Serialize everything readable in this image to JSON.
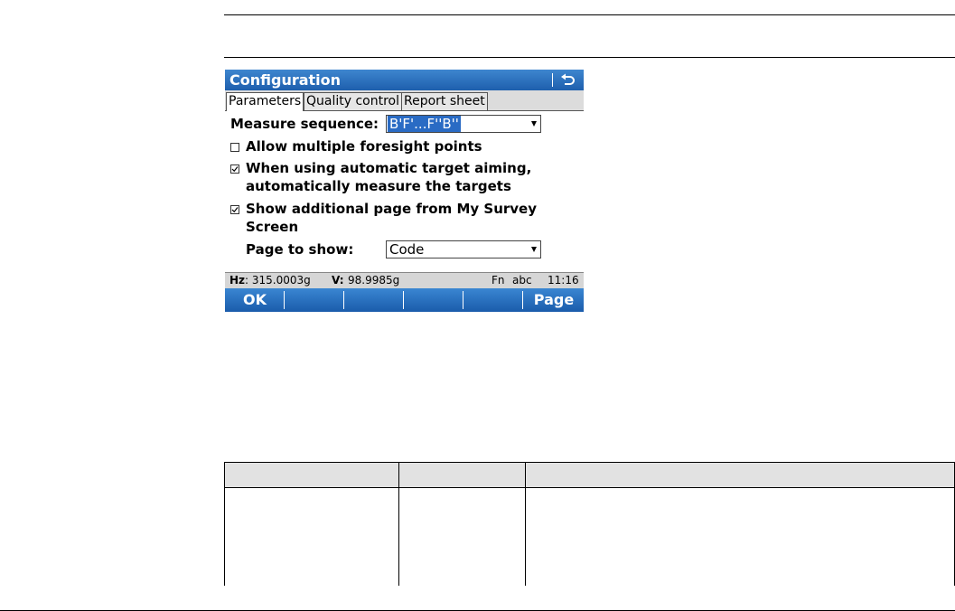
{
  "window": {
    "title": "Configuration",
    "back_icon": "back-arrow-icon"
  },
  "tabs": [
    {
      "label": "Parameters",
      "active": true
    },
    {
      "label": "Quality control",
      "active": false
    },
    {
      "label": "Report sheet",
      "active": false
    }
  ],
  "form": {
    "measure_sequence_label": "Measure sequence:",
    "measure_sequence_value": "B'F'...F''B''",
    "allow_multiple_label": "Allow multiple foresight points",
    "allow_multiple_checked": false,
    "auto_measure_line1": "When using automatic target aiming,",
    "auto_measure_line2": "automatically measure the targets",
    "auto_measure_checked": true,
    "show_page_line1": "Show additional page from My Survey",
    "show_page_line2": "Screen",
    "show_page_checked": true,
    "page_to_show_label": "Page to show:",
    "page_to_show_value": "Code"
  },
  "status": {
    "hz_label": "Hz",
    "hz_value": ": 315.0003g",
    "v_label": "V:",
    "v_value": "98.9985g",
    "fn": "Fn",
    "input_mode": "abc",
    "time": "11:16"
  },
  "softkeys": [
    "OK",
    "",
    "",
    "",
    "",
    "Page"
  ],
  "colors": {
    "title_blue": "#1e5fad",
    "selection_blue": "#2a6bc4"
  }
}
